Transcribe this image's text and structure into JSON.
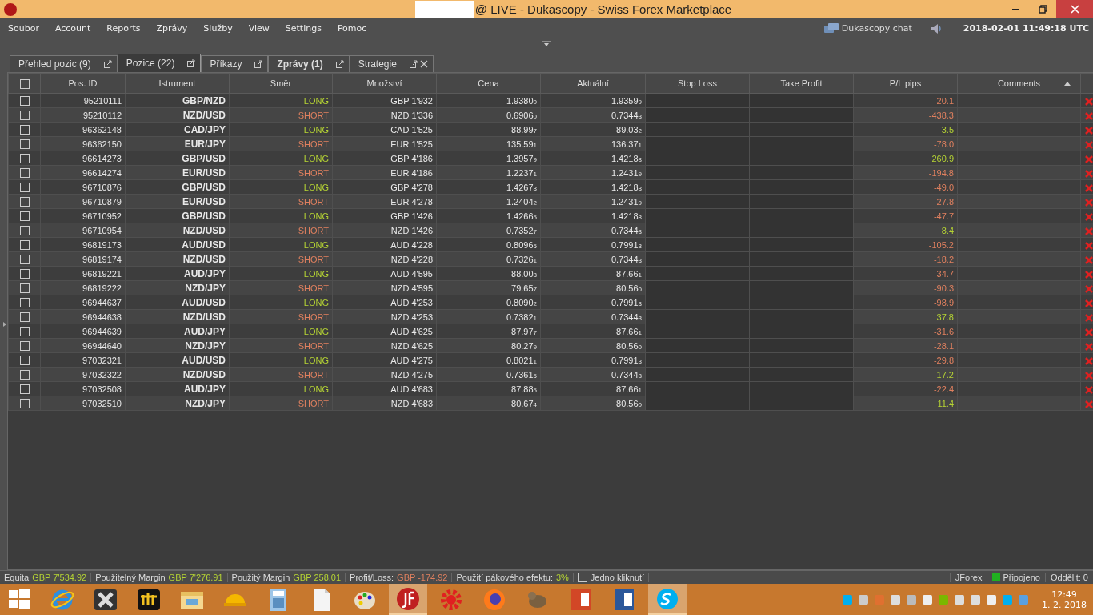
{
  "window": {
    "title": "@ LIVE - Dukascopy - Swiss Forex Marketplace"
  },
  "menu": [
    "Soubor",
    "Account",
    "Reports",
    "Zprávy",
    "Služby",
    "View",
    "Settings",
    "Pomoc"
  ],
  "toolbar": {
    "chat": "Dukascopy chat",
    "clock": "2018-02-01 11:49:18 UTC"
  },
  "tabs": [
    {
      "label": "Přehled pozic (9)",
      "selected": false,
      "bold": false,
      "closable": false
    },
    {
      "label": "Pozice (22)",
      "selected": true,
      "bold": false,
      "closable": false
    },
    {
      "label": "Příkazy",
      "selected": false,
      "bold": false,
      "closable": false
    },
    {
      "label": "Zprávy (1)",
      "selected": false,
      "bold": true,
      "closable": false
    },
    {
      "label": "Strategie",
      "selected": false,
      "bold": false,
      "closable": true
    }
  ],
  "table": {
    "all_checked": false,
    "columns": [
      {
        "label": "Pos. ID",
        "sorted": false
      },
      {
        "label": "Istrument",
        "sorted": false
      },
      {
        "label": "Směr",
        "sorted": false
      },
      {
        "label": "Množství",
        "sorted": false
      },
      {
        "label": "Cena",
        "sorted": false
      },
      {
        "label": "Aktuální",
        "sorted": false
      },
      {
        "label": "Stop Loss",
        "sorted": false
      },
      {
        "label": "Take Profit",
        "sorted": false
      },
      {
        "label": "P/L pips",
        "sorted": false
      },
      {
        "label": "Comments",
        "sorted": true
      }
    ],
    "rows": [
      {
        "id": "95210111",
        "instrument": "GBP/NZD",
        "kind": "long",
        "direction": "LONG",
        "amount": "GBP 1'932",
        "price": "1.9380$_{0}$",
        "current": "1.9359$_{9}$",
        "pl": "-20.1",
        "gain": false,
        "checked": false
      },
      {
        "id": "95210112",
        "instrument": "NZD/USD",
        "kind": "short",
        "direction": "SHORT",
        "amount": "NZD 1'336",
        "price": "0.6906$_{0}$",
        "current": "0.7344$_{3}$",
        "pl": "-438.3",
        "gain": false,
        "checked": false
      },
      {
        "id": "96362148",
        "instrument": "CAD/JPY",
        "kind": "long",
        "direction": "LONG",
        "amount": "CAD 1'525",
        "price": "88.99$_{7}$",
        "current": "89.03$_{2}$",
        "pl": "3.5",
        "gain": true,
        "checked": false
      },
      {
        "id": "96362150",
        "instrument": "EUR/JPY",
        "kind": "short",
        "direction": "SHORT",
        "amount": "EUR 1'525",
        "price": "135.59$_{1}$",
        "current": "136.37$_{1}$",
        "pl": "-78.0",
        "gain": false,
        "checked": false
      },
      {
        "id": "96614273",
        "instrument": "GBP/USD",
        "kind": "long",
        "direction": "LONG",
        "amount": "GBP 4'186",
        "price": "1.3957$_{9}$",
        "current": "1.4218$_{8}$",
        "pl": "260.9",
        "gain": true,
        "checked": false
      },
      {
        "id": "96614274",
        "instrument": "EUR/USD",
        "kind": "short",
        "direction": "SHORT",
        "amount": "EUR 4'186",
        "price": "1.2237$_{1}$",
        "current": "1.2431$_{9}$",
        "pl": "-194.8",
        "gain": false,
        "checked": false
      },
      {
        "id": "96710876",
        "instrument": "GBP/USD",
        "kind": "long",
        "direction": "LONG",
        "amount": "GBP 4'278",
        "price": "1.4267$_{8}$",
        "current": "1.4218$_{8}$",
        "pl": "-49.0",
        "gain": false,
        "checked": false
      },
      {
        "id": "96710879",
        "instrument": "EUR/USD",
        "kind": "short",
        "direction": "SHORT",
        "amount": "EUR 4'278",
        "price": "1.2404$_{2}$",
        "current": "1.2431$_{9}$",
        "pl": "-27.8",
        "gain": false,
        "checked": false
      },
      {
        "id": "96710952",
        "instrument": "GBP/USD",
        "kind": "long",
        "direction": "LONG",
        "amount": "GBP 1'426",
        "price": "1.4266$_{5}$",
        "current": "1.4218$_{8}$",
        "pl": "-47.7",
        "gain": false,
        "checked": false
      },
      {
        "id": "96710954",
        "instrument": "NZD/USD",
        "kind": "short",
        "direction": "SHORT",
        "amount": "NZD 1'426",
        "price": "0.7352$_{7}$",
        "current": "0.7344$_{3}$",
        "pl": "8.4",
        "gain": true,
        "checked": false
      },
      {
        "id": "96819173",
        "instrument": "AUD/USD",
        "kind": "long",
        "direction": "LONG",
        "amount": "AUD 4'228",
        "price": "0.8096$_{5}$",
        "current": "0.7991$_{3}$",
        "pl": "-105.2",
        "gain": false,
        "checked": false
      },
      {
        "id": "96819174",
        "instrument": "NZD/USD",
        "kind": "short",
        "direction": "SHORT",
        "amount": "NZD 4'228",
        "price": "0.7326$_{1}$",
        "current": "0.7344$_{3}$",
        "pl": "-18.2",
        "gain": false,
        "checked": false
      },
      {
        "id": "96819221",
        "instrument": "AUD/JPY",
        "kind": "long",
        "direction": "LONG",
        "amount": "AUD 4'595",
        "price": "88.00$_{8}$",
        "current": "87.66$_{1}$",
        "pl": "-34.7",
        "gain": false,
        "checked": false
      },
      {
        "id": "96819222",
        "instrument": "NZD/JPY",
        "kind": "short",
        "direction": "SHORT",
        "amount": "NZD 4'595",
        "price": "79.65$_{7}$",
        "current": "80.56$_{0}$",
        "pl": "-90.3",
        "gain": false,
        "checked": false
      },
      {
        "id": "96944637",
        "instrument": "AUD/USD",
        "kind": "long",
        "direction": "LONG",
        "amount": "AUD 4'253",
        "price": "0.8090$_{2}$",
        "current": "0.7991$_{3}$",
        "pl": "-98.9",
        "gain": false,
        "checked": false
      },
      {
        "id": "96944638",
        "instrument": "NZD/USD",
        "kind": "short",
        "direction": "SHORT",
        "amount": "NZD 4'253",
        "price": "0.7382$_{1}$",
        "current": "0.7344$_{3}$",
        "pl": "37.8",
        "gain": true,
        "checked": false
      },
      {
        "id": "96944639",
        "instrument": "AUD/JPY",
        "kind": "long",
        "direction": "LONG",
        "amount": "AUD 4'625",
        "price": "87.97$_{7}$",
        "current": "87.66$_{1}$",
        "pl": "-31.6",
        "gain": false,
        "checked": false
      },
      {
        "id": "96944640",
        "instrument": "NZD/JPY",
        "kind": "short",
        "direction": "SHORT",
        "amount": "NZD 4'625",
        "price": "80.27$_{9}$",
        "current": "80.56$_{0}$",
        "pl": "-28.1",
        "gain": false,
        "checked": false
      },
      {
        "id": "97032321",
        "instrument": "AUD/USD",
        "kind": "long",
        "direction": "LONG",
        "amount": "AUD 4'275",
        "price": "0.8021$_{1}$",
        "current": "0.7991$_{3}$",
        "pl": "-29.8",
        "gain": false,
        "checked": false
      },
      {
        "id": "97032322",
        "instrument": "NZD/USD",
        "kind": "short",
        "direction": "SHORT",
        "amount": "NZD 4'275",
        "price": "0.7361$_{5}$",
        "current": "0.7344$_{3}$",
        "pl": "17.2",
        "gain": true,
        "checked": false
      },
      {
        "id": "97032508",
        "instrument": "AUD/JPY",
        "kind": "long",
        "direction": "LONG",
        "amount": "AUD 4'683",
        "price": "87.88$_{5}$",
        "current": "87.66$_{1}$",
        "pl": "-22.4",
        "gain": false,
        "checked": false
      },
      {
        "id": "97032510",
        "instrument": "NZD/JPY",
        "kind": "short",
        "direction": "SHORT",
        "amount": "NZD 4'683",
        "price": "80.67$_{4}$",
        "current": "80.56$_{0}$",
        "pl": "11.4",
        "gain": true,
        "checked": false
      }
    ]
  },
  "status_bar": {
    "items": [
      {
        "label": "Equita",
        "value": "GBP 7'534.92",
        "gain": true
      },
      {
        "label": "Použitelný Margin",
        "value": "GBP 7'276.91",
        "gain": true
      },
      {
        "label": "Použitý Margin",
        "value": "GBP 258.01",
        "gain": true
      },
      {
        "label": "Profit/Loss:",
        "value": "GBP -174.92",
        "gain": false
      },
      {
        "label": "Použití pákového efektu:",
        "value": "3%",
        "gain": true
      }
    ],
    "single_click": {
      "label": "Jedno kliknutí",
      "checked": false
    },
    "platform": "JForex",
    "connection": {
      "label": "Připojeno",
      "connected": true
    },
    "detach": "Oddělit: 0"
  },
  "taskbar": {
    "apps": [
      {
        "kind": "windows",
        "selected": false
      },
      {
        "kind": "ie",
        "selected": false
      },
      {
        "kind": "x",
        "selected": false
      },
      {
        "kind": "bars",
        "selected": false
      },
      {
        "kind": "folder",
        "selected": false
      },
      {
        "kind": "helmet",
        "selected": false
      },
      {
        "kind": "calculator",
        "selected": false
      },
      {
        "kind": "document",
        "selected": false
      },
      {
        "kind": "palette",
        "selected": false
      },
      {
        "kind": "jforex",
        "selected": true
      },
      {
        "kind": "gear",
        "selected": false
      },
      {
        "kind": "firefox",
        "selected": false
      },
      {
        "kind": "animal",
        "selected": false
      },
      {
        "kind": "powerpoint",
        "selected": false
      },
      {
        "kind": "word",
        "selected": false
      },
      {
        "kind": "skype",
        "selected": true
      }
    ],
    "time": "12:49",
    "date": "1. 2. 2018"
  }
}
